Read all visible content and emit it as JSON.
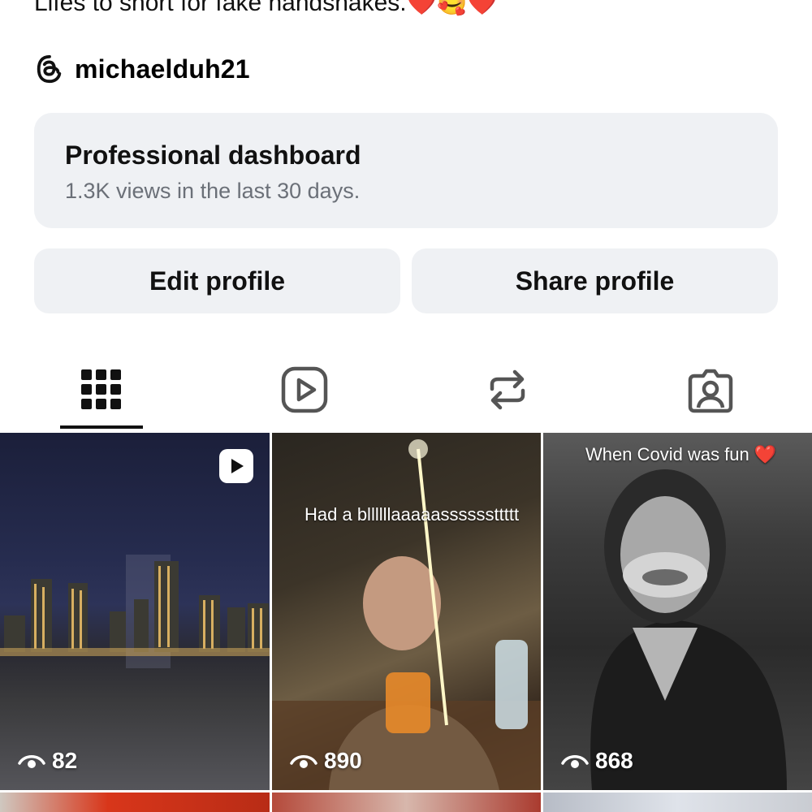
{
  "profile": {
    "bio": "Lifes to short for fake handshakes.",
    "bio_emoji": "❤️🥰❤️",
    "threads_handle": "michaelduh21"
  },
  "dashboard": {
    "title": "Professional dashboard",
    "subtitle": "1.3K views in the last 30 days."
  },
  "actions": {
    "edit_label": "Edit profile",
    "share_label": "Share profile"
  },
  "tabs": [
    {
      "icon": "grid-icon",
      "active": true
    },
    {
      "icon": "reels-icon",
      "active": false
    },
    {
      "icon": "reposts-icon",
      "active": false
    },
    {
      "icon": "tagged-icon",
      "active": false
    }
  ],
  "posts": [
    {
      "views": "82",
      "is_reel": true,
      "caption": ""
    },
    {
      "views": "890",
      "is_reel": false,
      "caption": "Had a bllllllaaaaassssssttttt"
    },
    {
      "views": "868",
      "is_reel": false,
      "caption": "When Covid was fun ❤️"
    }
  ],
  "colors": {
    "card_bg": "#eff1f4",
    "muted_text": "#6b7078",
    "heart": "#e0202a"
  }
}
